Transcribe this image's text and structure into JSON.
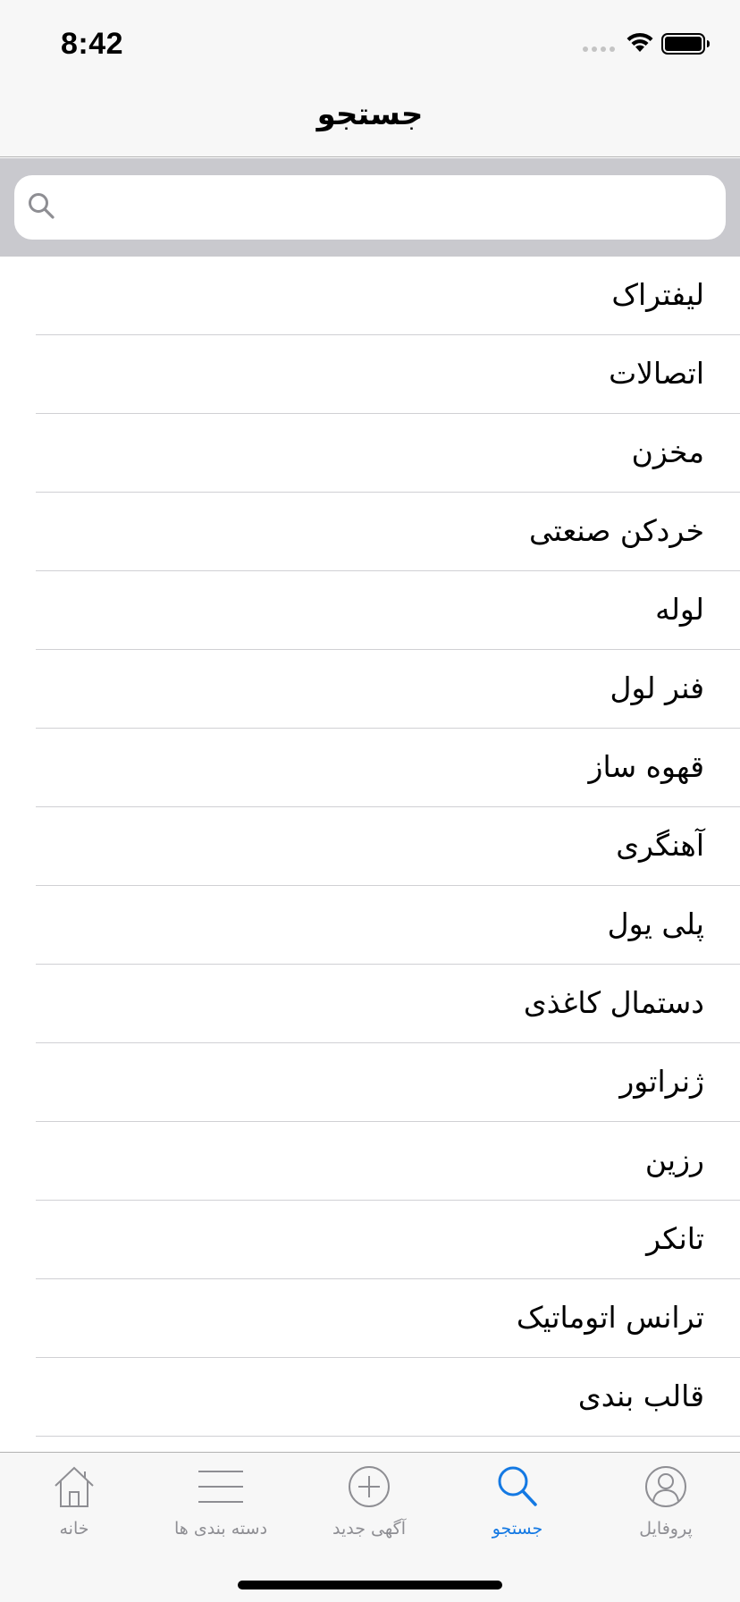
{
  "status": {
    "time": "8:42"
  },
  "nav": {
    "title": "جستجو"
  },
  "search": {
    "placeholder": "",
    "value": ""
  },
  "items": [
    "لیفتراک",
    "اتصالات",
    "مخزن",
    "خردکن صنعتی",
    "لوله",
    "فنر لول",
    "قهوه ساز",
    "آهنگری",
    "پلی یول",
    "دستمال کاغذی",
    "ژنراتور",
    "رزین",
    "تانکر",
    "ترانس اتوماتیک",
    "قالب بندی"
  ],
  "tabs": [
    {
      "label": "خانه",
      "icon": "home-icon",
      "active": false
    },
    {
      "label": "دسته بندی ها",
      "icon": "list-icon",
      "active": false
    },
    {
      "label": "آگهی جدید",
      "icon": "add-circle-icon",
      "active": false
    },
    {
      "label": "جستجو",
      "icon": "search-icon",
      "active": true
    },
    {
      "label": "پروفایل",
      "icon": "profile-icon",
      "active": false
    }
  ],
  "colors": {
    "accent": "#1479e3",
    "inactive": "#8e8e93",
    "search_bg": "#c9c9ce",
    "bar_bg": "#f7f7f7"
  }
}
